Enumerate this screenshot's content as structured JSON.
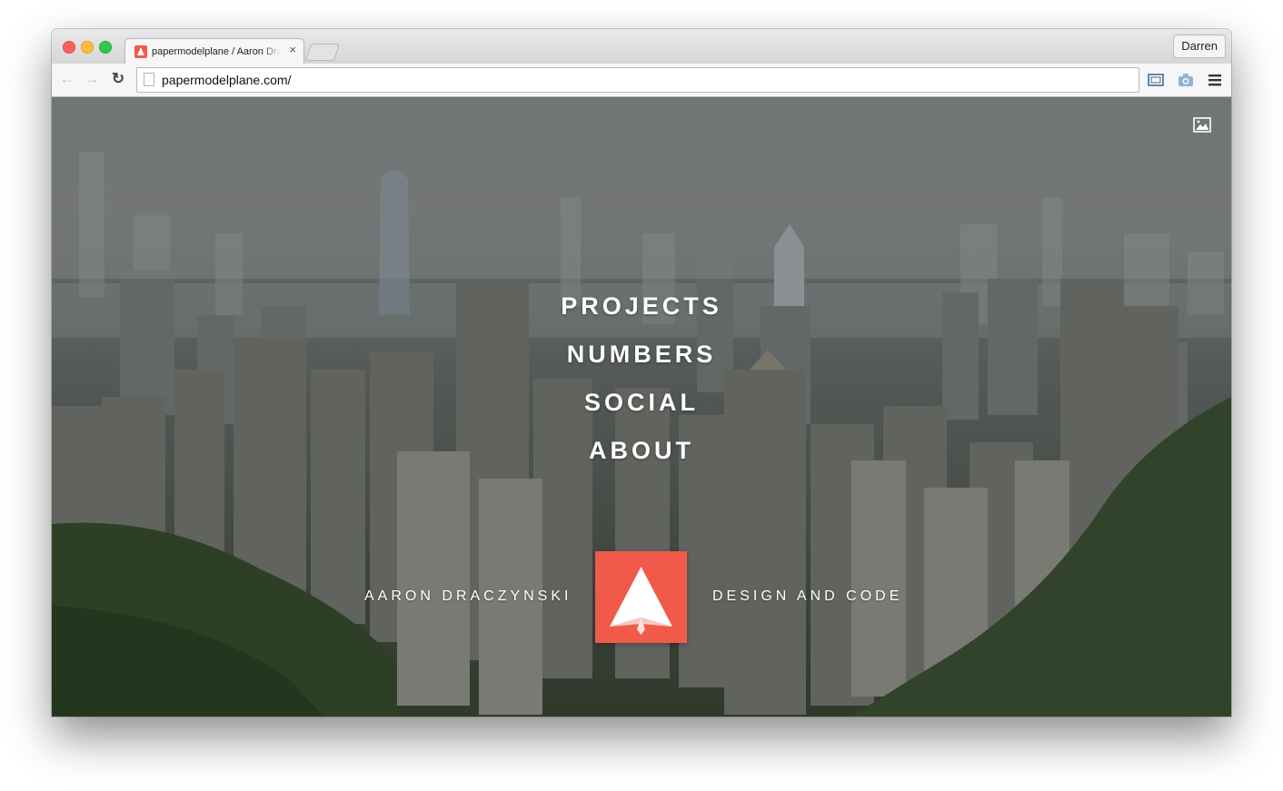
{
  "browser": {
    "tab_title": "papermodelplane / Aaron Draczynski",
    "tab_close": "×",
    "profile_name": "Darren",
    "url": "papermodelplane.com/",
    "back_glyph": "←",
    "forward_glyph": "→",
    "reload_glyph": "↻"
  },
  "icons": {
    "favicon": "paper-plane-logo-icon",
    "page": "page-icon",
    "cast": "cast-icon",
    "camera": "camera-icon",
    "menu": "hamburger-menu-icon",
    "background_toggle": "image-icon"
  },
  "site": {
    "nav": [
      "PROJECTS",
      "NUMBERS",
      "SOCIAL",
      "ABOUT"
    ],
    "author_name": "AARON DRACZYNSKI",
    "tagline": "DESIGN AND CODE"
  },
  "colors": {
    "brand_red": "#f15a4a",
    "nav_text": "#ffffff"
  }
}
